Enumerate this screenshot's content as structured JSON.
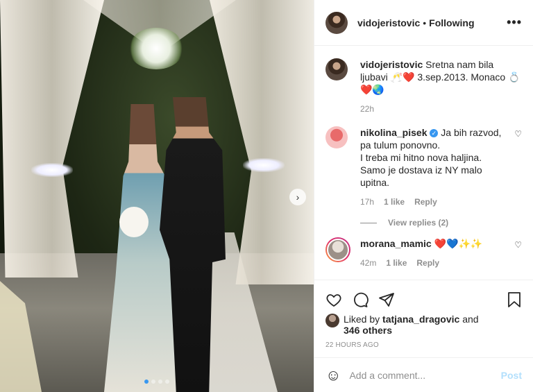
{
  "post": {
    "author": "vidojeristovic",
    "follow_status": "Following",
    "more": "•••",
    "caption": "Sretna nam bila ljubavi 🥂❤️ 3.sep.2013. Monaco 💍❤️🌏",
    "caption_time": "22h"
  },
  "photo": {
    "next": "›",
    "slide_count": 4,
    "active_slide": 1
  },
  "comments": [
    {
      "user": "nikolina_pisek",
      "verified": true,
      "text": "Ja bih razvod, pa tulum ponovno.\nI treba mi hitno nova haljina.\nSamo je dostava iz NY malo upitna.",
      "time": "17h",
      "likes": "1 like",
      "reply": "Reply",
      "view_replies": "View replies (2)"
    },
    {
      "user": "morana_mamic",
      "text": "❤️💙✨✨",
      "time": "42m",
      "likes": "1 like",
      "reply": "Reply"
    }
  ],
  "actions": {
    "liked_by_prefix": "Liked by ",
    "liked_by_user": "tatjana_dragovic",
    "liked_by_and": " and",
    "others": "346 others",
    "timestamp": "22 HOURS AGO"
  },
  "add_comment": {
    "placeholder": "Add a comment...",
    "post_label": "Post"
  }
}
